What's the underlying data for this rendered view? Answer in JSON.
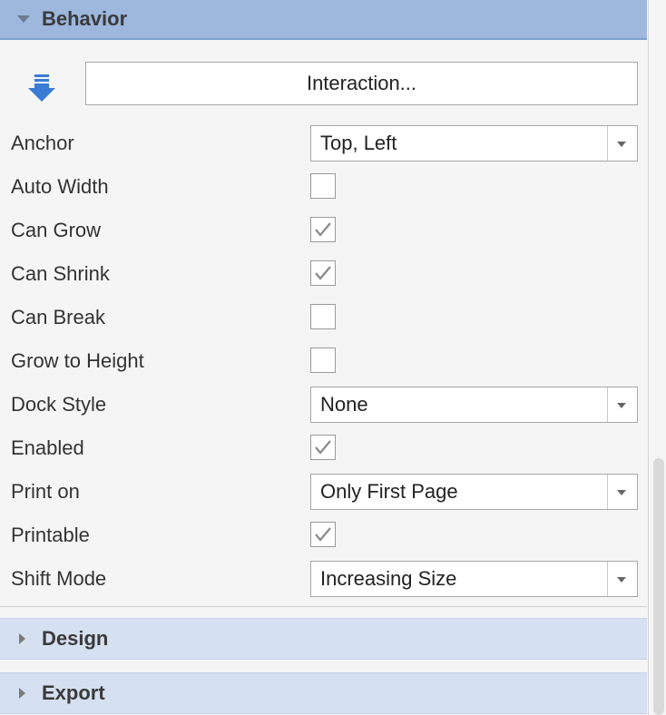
{
  "sections": {
    "behavior": {
      "title": "Behavior",
      "expanded": true
    },
    "design": {
      "title": "Design",
      "expanded": false
    },
    "export": {
      "title": "Export",
      "expanded": false
    }
  },
  "interaction_button": {
    "label": "Interaction...",
    "icon": "arrow-down-icon"
  },
  "properties": {
    "anchor": {
      "label": "Anchor",
      "type": "dropdown",
      "value": "Top, Left"
    },
    "auto_width": {
      "label": "Auto Width",
      "type": "checkbox",
      "checked": false
    },
    "can_grow": {
      "label": "Can Grow",
      "type": "checkbox",
      "checked": true
    },
    "can_shrink": {
      "label": "Can Shrink",
      "type": "checkbox",
      "checked": true
    },
    "can_break": {
      "label": "Can Break",
      "type": "checkbox",
      "checked": false
    },
    "grow_to_height": {
      "label": "Grow to Height",
      "type": "checkbox",
      "checked": false
    },
    "dock_style": {
      "label": "Dock Style",
      "type": "dropdown",
      "value": "None"
    },
    "enabled": {
      "label": "Enabled",
      "type": "checkbox",
      "checked": true
    },
    "print_on": {
      "label": "Print on",
      "type": "dropdown",
      "value": "Only First Page"
    },
    "printable": {
      "label": "Printable",
      "type": "checkbox",
      "checked": true
    },
    "shift_mode": {
      "label": "Shift Mode",
      "type": "dropdown",
      "value": "Increasing Size"
    }
  },
  "colors": {
    "expanded_header": "#9db7dd",
    "collapsed_header": "#d5e0f0",
    "arrow_icon": "#3a7bd5",
    "checkmark": "#8a8a8a"
  }
}
